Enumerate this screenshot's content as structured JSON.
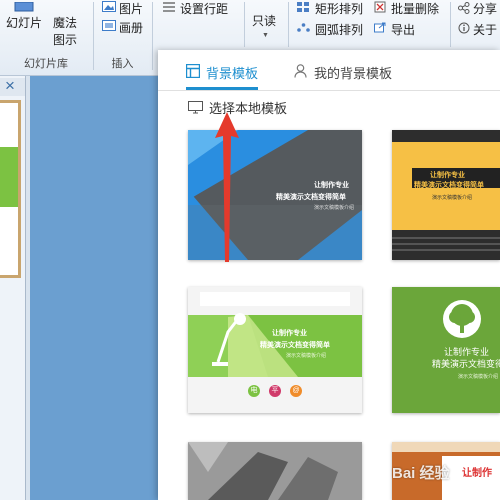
{
  "ribbon": {
    "slide_label": "幻灯片",
    "theme_label_1": "魔法",
    "theme_label_2": "图示",
    "group_slides": "幻灯片库",
    "picture_label": "图片",
    "album_label": "画册",
    "group_insert": "插入",
    "spacing_label": "设置行距",
    "readonly_label": "只读",
    "rect_arrange_label": "矩形排列",
    "arc_arrange_label": "圆弧排列",
    "batch_delete_label": "批量删除",
    "export_label": "导出",
    "share_label": "分享",
    "about_label": "关于"
  },
  "left": {
    "close_glyph": "×"
  },
  "panel": {
    "tab_bg": "背景模板",
    "tab_my": "我的背景模板",
    "choose_local": "选择本地模板",
    "accent": "#1e8fcf"
  },
  "templates": [
    {
      "line1": "让制作专业",
      "line2": "精美演示文档变得简单",
      "line3": "演示文稿模板介绍"
    },
    {
      "line1": "让制作专业",
      "line2": "精美演示文档变得简单",
      "line3": "演示文稿模板介绍"
    },
    {
      "line1": "让制作专业",
      "line2": "精美演示文档变得简单",
      "line3": "演示文稿模板介绍",
      "btn1": "电",
      "btn2": "平",
      "btn3": "@"
    },
    {
      "line1": "让制作专业",
      "line2": "精美演示文档变得",
      "line3": "演示文稿模板介绍"
    },
    {
      "line1": "让制作"
    }
  ],
  "watermark": "Bai 经验"
}
